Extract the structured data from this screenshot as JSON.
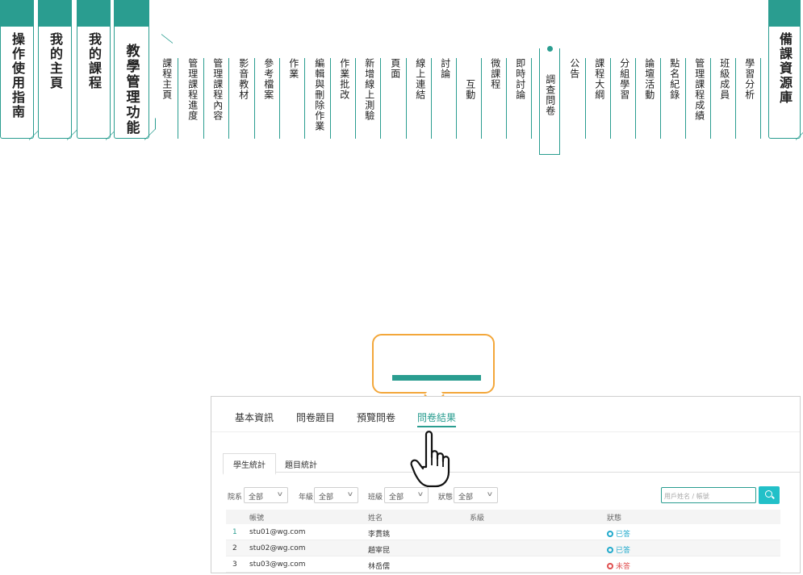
{
  "colors": {
    "accent": "#2a9d90",
    "callout_border": "#f3a73a",
    "search_button": "#22c0c8",
    "status_done": "#22aacc",
    "status_not_done": "#e05050"
  },
  "main_tabs": [
    {
      "label": "操作使用指南"
    },
    {
      "label": "我的主頁"
    },
    {
      "label": "我的課程"
    },
    {
      "label": "教學管理功能"
    }
  ],
  "right_tab": {
    "label": "備課資源庫"
  },
  "sub_tabs": [
    {
      "label": "課程主頁"
    },
    {
      "label": "管理課程進度"
    },
    {
      "label": "管理課程內容"
    },
    {
      "label": "影音教材"
    },
    {
      "label": "參考檔案"
    },
    {
      "label": "作業"
    },
    {
      "label": "編輯與刪除作業"
    },
    {
      "label": "作業批改"
    },
    {
      "label": "新增線上測驗"
    },
    {
      "label": "頁面"
    },
    {
      "label": "線上連結"
    },
    {
      "label": "討論"
    },
    {
      "label": "互動"
    },
    {
      "label": "微課程"
    },
    {
      "label": "即時討論"
    },
    {
      "label": "調查問卷"
    },
    {
      "label": "公告"
    },
    {
      "label": "課程大綱"
    },
    {
      "label": "分組學習"
    },
    {
      "label": "論壇活動"
    },
    {
      "label": "點名紀錄"
    },
    {
      "label": "管理課程成績"
    },
    {
      "label": "班級成員"
    },
    {
      "label": "學習分析"
    }
  ],
  "active_sub_tab": "調查問卷",
  "screenshot": {
    "top_tabs": [
      "基本資訊",
      "問卷題目",
      "預覽問卷",
      "問卷結果"
    ],
    "active_top_tab": "問卷結果",
    "sub_tabs": [
      "學生統計",
      "題目統計"
    ],
    "filters": [
      {
        "label": "院系",
        "value": "全部"
      },
      {
        "label": "年級",
        "value": "全部"
      },
      {
        "label": "班級",
        "value": "全部"
      },
      {
        "label": "狀態",
        "value": "全部"
      }
    ],
    "search": {
      "placeholder": "用戶姓名 / 帳號"
    },
    "table": {
      "headers": [
        "帳號",
        "姓名",
        "系級",
        "狀態"
      ],
      "rows": [
        {
          "no": "1",
          "account": "stu01@wg.com",
          "name": "李貫銚",
          "dept": "",
          "status": "已答"
        },
        {
          "no": "2",
          "account": "stu02@wg.com",
          "name": "趙宰昆",
          "dept": "",
          "status": "已答"
        },
        {
          "no": "3",
          "account": "stu03@wg.com",
          "name": "林岳儒",
          "dept": "",
          "status": "未答"
        }
      ]
    }
  }
}
